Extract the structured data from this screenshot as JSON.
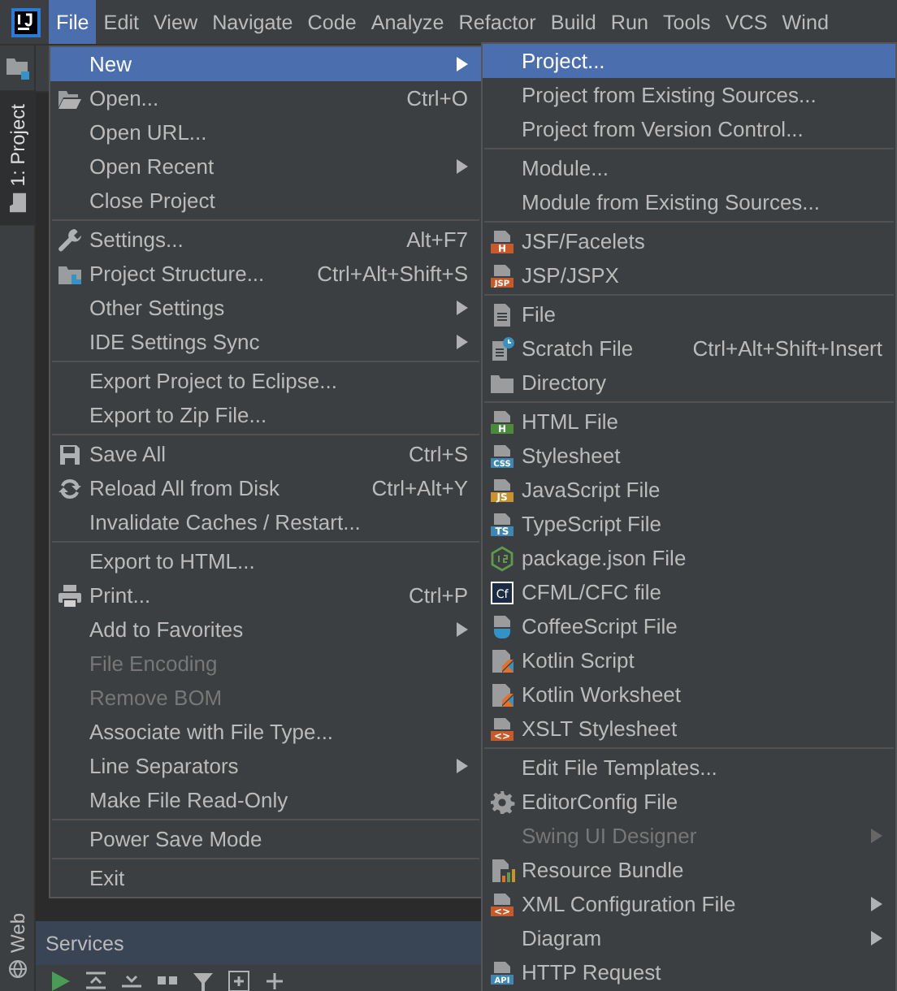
{
  "menu_bar": {
    "items": [
      {
        "label": "File",
        "selected": true
      },
      {
        "label": "Edit",
        "selected": false
      },
      {
        "label": "View",
        "selected": false
      },
      {
        "label": "Navigate",
        "selected": false
      },
      {
        "label": "Code",
        "selected": false
      },
      {
        "label": "Analyze",
        "selected": false
      },
      {
        "label": "Refactor",
        "selected": false
      },
      {
        "label": "Build",
        "selected": false
      },
      {
        "label": "Run",
        "selected": false
      },
      {
        "label": "Tools",
        "selected": false
      },
      {
        "label": "VCS",
        "selected": false
      },
      {
        "label": "Wind",
        "selected": false
      }
    ]
  },
  "tool_strip": {
    "tabs": [
      {
        "label": "1: Project",
        "selected": true
      },
      {
        "label": "Web",
        "selected": false
      }
    ]
  },
  "file_menu": {
    "items": [
      {
        "kind": "plain",
        "label": "New",
        "submenu": true,
        "selected": true,
        "disabled": false
      },
      {
        "kind": "opener",
        "label": "Open...",
        "shortcut": "Ctrl+O",
        "submenu": false,
        "selected": false,
        "disabled": false
      },
      {
        "kind": "plain",
        "label": "Open URL...",
        "submenu": false,
        "selected": false,
        "disabled": false
      },
      {
        "kind": "plain",
        "label": "Open Recent",
        "submenu": true,
        "selected": false,
        "disabled": false
      },
      {
        "kind": "plain",
        "label": "Close Project",
        "submenu": false,
        "selected": false,
        "disabled": false
      },
      {
        "kind": "separator"
      },
      {
        "kind": "wrench",
        "label": "Settings...",
        "shortcut": "Alt+F7",
        "submenu": false,
        "selected": false,
        "disabled": false
      },
      {
        "kind": "structure",
        "label": "Project Structure...",
        "shortcut": "Ctrl+Alt+Shift+S",
        "submenu": false,
        "selected": false,
        "disabled": false
      },
      {
        "kind": "plain",
        "label": "Other Settings",
        "submenu": true,
        "selected": false,
        "disabled": false
      },
      {
        "kind": "plain",
        "label": "IDE Settings Sync",
        "submenu": true,
        "selected": false,
        "disabled": false
      },
      {
        "kind": "separator"
      },
      {
        "kind": "plain",
        "label": "Export Project to Eclipse...",
        "submenu": false,
        "selected": false,
        "disabled": false
      },
      {
        "kind": "plain",
        "label": "Export to Zip File...",
        "submenu": false,
        "selected": false,
        "disabled": false
      },
      {
        "kind": "separator"
      },
      {
        "kind": "save",
        "label": "Save All",
        "shortcut": "Ctrl+S",
        "submenu": false,
        "selected": false,
        "disabled": false
      },
      {
        "kind": "reload",
        "label": "Reload All from Disk",
        "shortcut": "Ctrl+Alt+Y",
        "submenu": false,
        "selected": false,
        "disabled": false
      },
      {
        "kind": "plain",
        "label": "Invalidate Caches / Restart...",
        "submenu": false,
        "selected": false,
        "disabled": false
      },
      {
        "kind": "separator"
      },
      {
        "kind": "plain",
        "label": "Export to HTML...",
        "submenu": false,
        "selected": false,
        "disabled": false
      },
      {
        "kind": "printer",
        "label": "Print...",
        "shortcut": "Ctrl+P",
        "submenu": false,
        "selected": false,
        "disabled": false
      },
      {
        "kind": "plain",
        "label": "Add to Favorites",
        "submenu": true,
        "selected": false,
        "disabled": false
      },
      {
        "kind": "plain",
        "label": "File Encoding",
        "submenu": false,
        "selected": false,
        "disabled": true
      },
      {
        "kind": "plain",
        "label": "Remove BOM",
        "submenu": false,
        "selected": false,
        "disabled": true
      },
      {
        "kind": "plain",
        "label": "Associate with File Type...",
        "submenu": false,
        "selected": false,
        "disabled": false
      },
      {
        "kind": "plain",
        "label": "Line Separators",
        "submenu": true,
        "selected": false,
        "disabled": false
      },
      {
        "kind": "plain",
        "label": "Make File Read-Only",
        "submenu": false,
        "selected": false,
        "disabled": false
      },
      {
        "kind": "separator"
      },
      {
        "kind": "plain",
        "label": "Power Save Mode",
        "submenu": false,
        "selected": false,
        "disabled": false
      },
      {
        "kind": "separator"
      },
      {
        "kind": "plain",
        "label": "Exit",
        "submenu": false,
        "selected": false,
        "disabled": false
      }
    ]
  },
  "new_submenu": {
    "items": [
      {
        "kind": "plain",
        "label": "Project...",
        "submenu": false,
        "selected": true,
        "disabled": false
      },
      {
        "kind": "plain",
        "label": "Project from Existing Sources...",
        "submenu": false,
        "selected": false,
        "disabled": false
      },
      {
        "kind": "plain",
        "label": "Project from Version Control...",
        "submenu": false,
        "selected": false,
        "disabled": false
      },
      {
        "kind": "separator"
      },
      {
        "kind": "plain",
        "label": "Module...",
        "submenu": false,
        "selected": false,
        "disabled": false
      },
      {
        "kind": "plain",
        "label": "Module from Existing Sources...",
        "submenu": false,
        "selected": false,
        "disabled": false
      },
      {
        "kind": "separator"
      },
      {
        "kind": "badged",
        "label": "JSF/Facelets",
        "badge": "H",
        "color": "#c75a2a",
        "submenu": false,
        "selected": false,
        "disabled": false
      },
      {
        "kind": "badged",
        "label": "JSP/JSPX",
        "badge": "JSP",
        "color": "#c75a2a",
        "submenu": false,
        "selected": false,
        "disabled": false
      },
      {
        "kind": "separator"
      },
      {
        "kind": "file",
        "label": "File",
        "submenu": false,
        "selected": false,
        "disabled": false
      },
      {
        "kind": "scratch",
        "label": "Scratch File",
        "shortcut": "Ctrl+Alt+Shift+Insert",
        "submenu": false,
        "selected": false,
        "disabled": false
      },
      {
        "kind": "folder",
        "label": "Directory",
        "submenu": false,
        "selected": false,
        "disabled": false
      },
      {
        "kind": "separator"
      },
      {
        "kind": "badged",
        "label": "HTML File",
        "badge": "H",
        "color": "#4a8a3a",
        "submenu": false,
        "selected": false,
        "disabled": false
      },
      {
        "kind": "badged",
        "label": "Stylesheet",
        "badge": "CSS",
        "color": "#3f87b0",
        "submenu": false,
        "selected": false,
        "disabled": false
      },
      {
        "kind": "badged",
        "label": "JavaScript File",
        "badge": "JS",
        "color": "#c8922e",
        "submenu": false,
        "selected": false,
        "disabled": false
      },
      {
        "kind": "badged",
        "label": "TypeScript File",
        "badge": "TS",
        "color": "#3f87b0",
        "submenu": false,
        "selected": false,
        "disabled": false
      },
      {
        "kind": "hexagon",
        "label": "package.json File",
        "submenu": false,
        "selected": false,
        "disabled": false
      },
      {
        "kind": "cfml",
        "label": "CFML/CFC file",
        "badge": "Cf",
        "submenu": false,
        "selected": false,
        "disabled": false
      },
      {
        "kind": "coffee",
        "label": "CoffeeScript File",
        "submenu": false,
        "selected": false,
        "disabled": false
      },
      {
        "kind": "kotlin",
        "label": "Kotlin Script",
        "submenu": false,
        "selected": false,
        "disabled": false
      },
      {
        "kind": "kotlin",
        "label": "Kotlin Worksheet",
        "submenu": false,
        "selected": false,
        "disabled": false
      },
      {
        "kind": "badged",
        "label": "XSLT Stylesheet",
        "badge": "<>",
        "color": "#c75a2a",
        "submenu": false,
        "selected": false,
        "disabled": false
      },
      {
        "kind": "separator"
      },
      {
        "kind": "plain",
        "label": "Edit File Templates...",
        "submenu": false,
        "selected": false,
        "disabled": false
      },
      {
        "kind": "gear",
        "label": "EditorConfig File",
        "submenu": false,
        "selected": false,
        "disabled": false
      },
      {
        "kind": "plain",
        "label": "Swing UI Designer",
        "submenu": true,
        "selected": false,
        "disabled": true
      },
      {
        "kind": "bundle",
        "label": "Resource Bundle",
        "submenu": false,
        "selected": false,
        "disabled": false
      },
      {
        "kind": "badged",
        "label": "XML Configuration File",
        "badge": "<>",
        "color": "#c75a2a",
        "submenu": true,
        "selected": false,
        "disabled": false
      },
      {
        "kind": "plain",
        "label": "Diagram",
        "submenu": true,
        "selected": false,
        "disabled": false
      },
      {
        "kind": "badged",
        "label": "HTTP Request",
        "badge": "API",
        "color": "#3f87b0",
        "submenu": false,
        "selected": false,
        "disabled": false
      }
    ]
  },
  "services_panel": {
    "title": "Services"
  }
}
